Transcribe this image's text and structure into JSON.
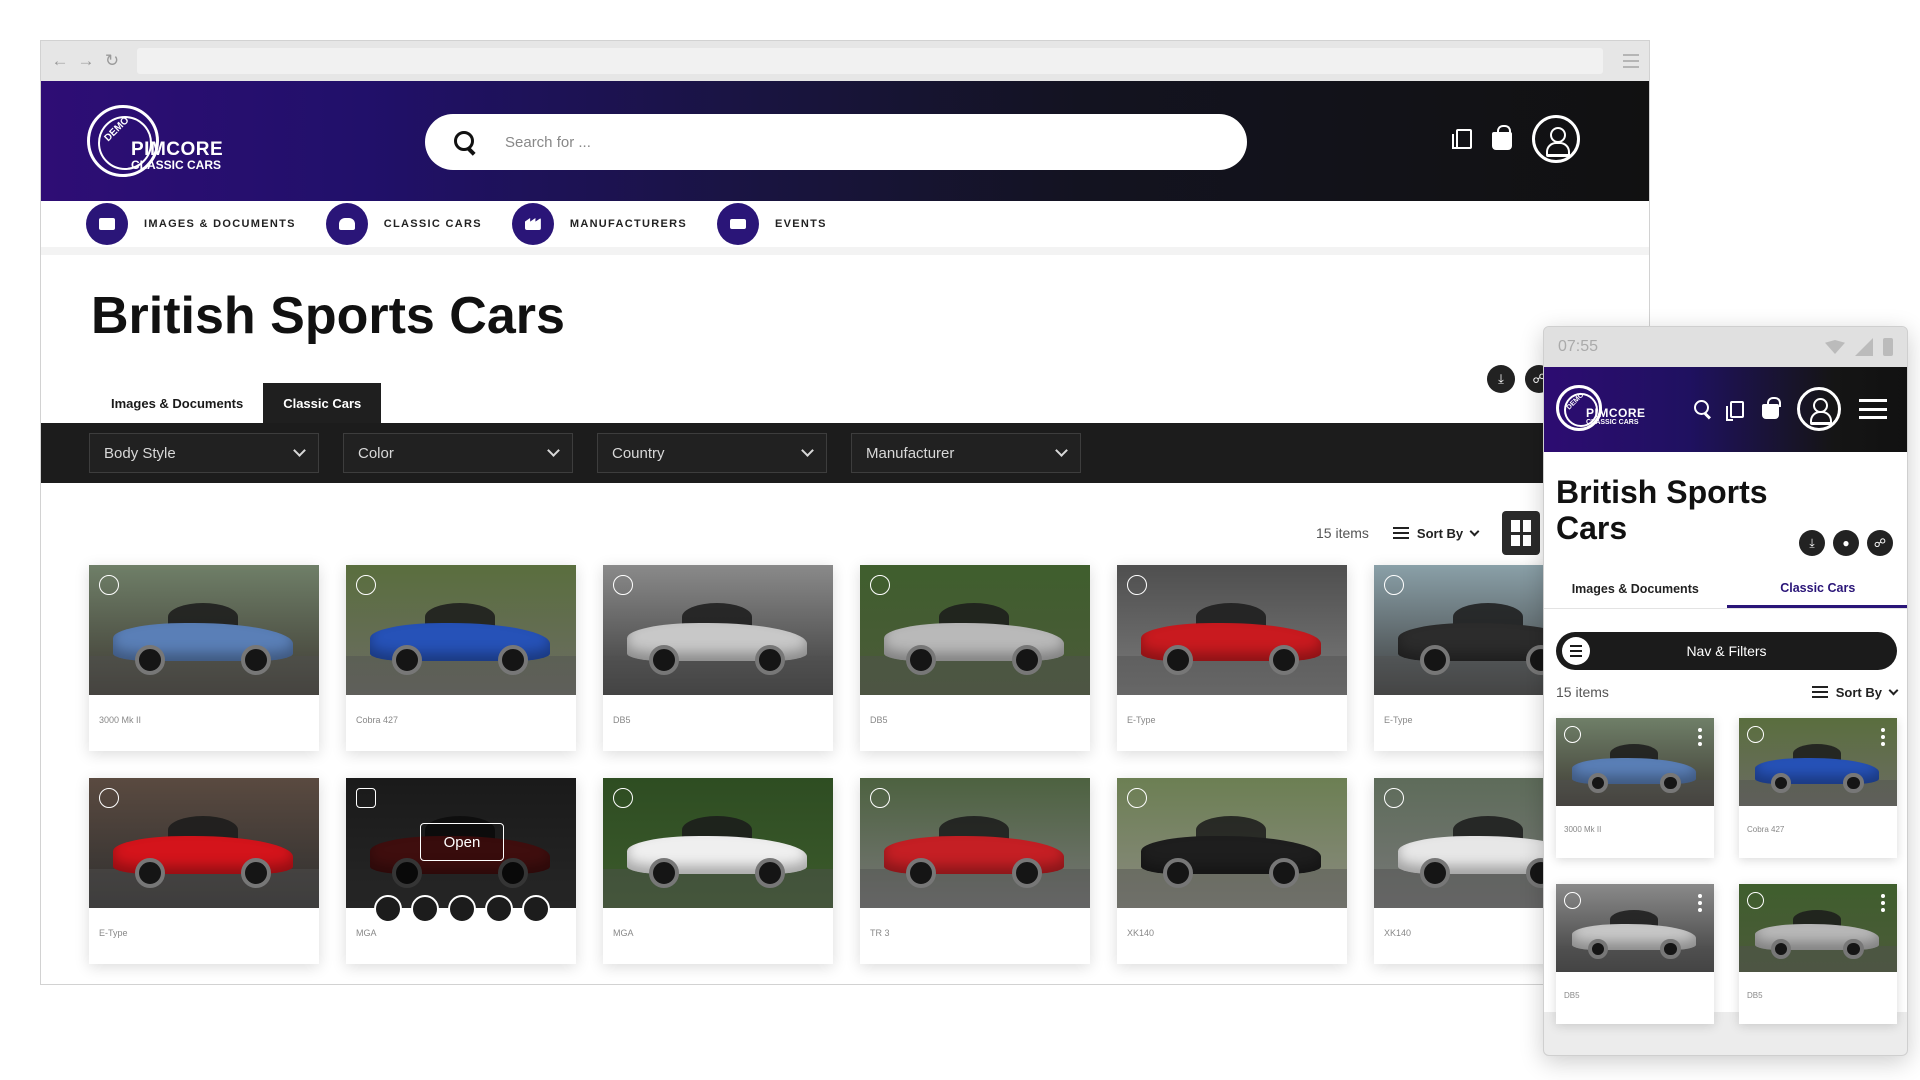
{
  "desktop": {
    "search": {
      "placeholder": "Search for ..."
    },
    "logo": {
      "seal": "DEMO",
      "brand": "PIMCORE",
      "sub": "CLASSIC CARS"
    },
    "nav": [
      {
        "label": "IMAGES & DOCUMENTS",
        "icon": "image-icon"
      },
      {
        "label": "CLASSIC CARS",
        "icon": "car-icon"
      },
      {
        "label": "MANUFACTURERS",
        "icon": "factory-icon"
      },
      {
        "label": "EVENTS",
        "icon": "ticket-icon"
      }
    ],
    "title": "British Sports Cars",
    "tabs": [
      {
        "label": "Images & Documents",
        "active": false
      },
      {
        "label": "Classic Cars",
        "active": true
      }
    ],
    "filters": [
      "Body Style",
      "Color",
      "Country",
      "Manufacturer"
    ],
    "count_label": "15 items",
    "sort_label": "Sort By",
    "hover_open_label": "Open",
    "cards": [
      {
        "name": "3000 Mk II",
        "color": "#5a7fb7"
      },
      {
        "name": "Cobra 427",
        "color": "#2652b8"
      },
      {
        "name": "DB5",
        "color": "#c8c8c8"
      },
      {
        "name": "DB5",
        "color": "#b9b9b9"
      },
      {
        "name": "E-Type",
        "color": "#c91a1f"
      },
      {
        "name": "E-Type",
        "color": "#2c2c2c"
      },
      {
        "name": "E-Type",
        "color": "#d4141b"
      },
      {
        "name": "MGA",
        "color": "#8c1f1f"
      },
      {
        "name": "MGA",
        "color": "#efefef"
      },
      {
        "name": "TR 3",
        "color": "#c51f24"
      },
      {
        "name": "XK140",
        "color": "#1e1e1e"
      },
      {
        "name": "XK140",
        "color": "#e7e7e7"
      }
    ]
  },
  "mobile": {
    "time": "07:55",
    "title": "British Sports Cars",
    "tabs": [
      {
        "label": "Images & Documents",
        "active": false
      },
      {
        "label": "Classic Cars",
        "active": true
      }
    ],
    "nav_filters_label": "Nav & Filters",
    "count_label": "15 items",
    "sort_label": "Sort By",
    "cards": [
      {
        "name": "3000 Mk II",
        "color": "#5a7fb7"
      },
      {
        "name": "Cobra 427",
        "color": "#2652b8"
      },
      {
        "name": "DB5",
        "color": "#c8c8c8"
      },
      {
        "name": "DB5",
        "color": "#b9b9b9"
      }
    ]
  },
  "colors": {
    "brand_purple": "#2a1578",
    "dark": "#1c1c1c"
  }
}
